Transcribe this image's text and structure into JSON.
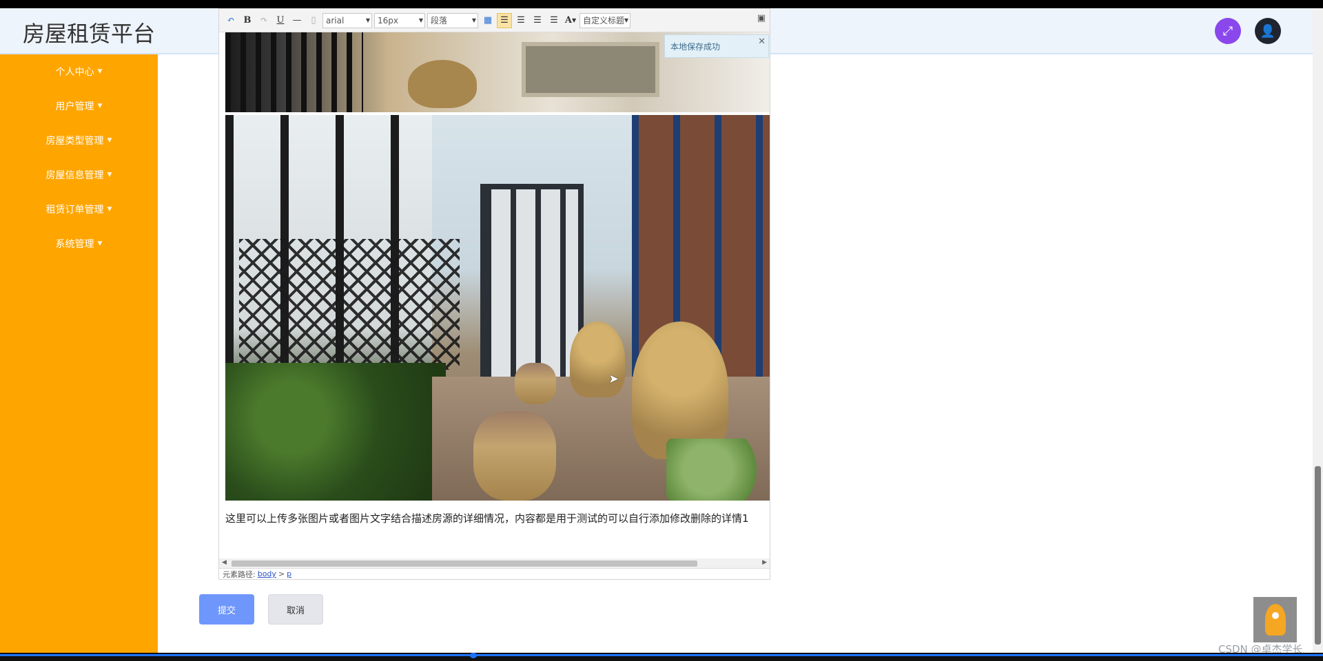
{
  "app": {
    "title": "房屋租赁平台"
  },
  "sidebar": {
    "items": [
      {
        "label": "个人中心"
      },
      {
        "label": "用户管理"
      },
      {
        "label": "房屋类型管理"
      },
      {
        "label": "房屋信息管理"
      },
      {
        "label": "租赁订单管理"
      },
      {
        "label": "系统管理"
      }
    ]
  },
  "editor": {
    "toolbar": {
      "font_family": "arial",
      "font_size": "16px",
      "paragraph": "段落",
      "custom_title": "自定义标题"
    },
    "description": "这里可以上传多张图片或者图片文字结合描述房源的详细情况，内容都是用于测试的可以自行添加修改删除的详情1",
    "element_path": {
      "label": "元素路径:",
      "body": "body",
      "sep": ">",
      "p": "p"
    }
  },
  "toast": {
    "text": "本地保存成功"
  },
  "buttons": {
    "submit": "提交",
    "cancel": "取消"
  },
  "watermark": "CSDN @卓杰学长",
  "colors": {
    "sidebar": "#ffa500",
    "submit": "#6f97fb",
    "fullscreen": "#8a47ec"
  }
}
